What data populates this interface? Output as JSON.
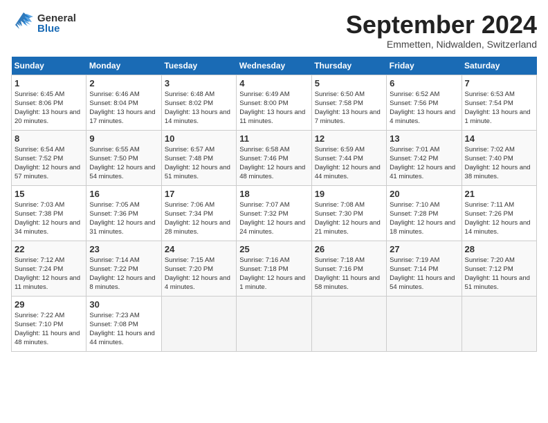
{
  "header": {
    "logo_general": "General",
    "logo_blue": "Blue",
    "month_title": "September 2024",
    "location": "Emmetten, Nidwalden, Switzerland"
  },
  "days_of_week": [
    "Sunday",
    "Monday",
    "Tuesday",
    "Wednesday",
    "Thursday",
    "Friday",
    "Saturday"
  ],
  "weeks": [
    [
      {
        "day": 1,
        "sunrise": "6:45 AM",
        "sunset": "8:06 PM",
        "daylight": "13 hours and 20 minutes."
      },
      {
        "day": 2,
        "sunrise": "6:46 AM",
        "sunset": "8:04 PM",
        "daylight": "13 hours and 17 minutes."
      },
      {
        "day": 3,
        "sunrise": "6:48 AM",
        "sunset": "8:02 PM",
        "daylight": "13 hours and 14 minutes."
      },
      {
        "day": 4,
        "sunrise": "6:49 AM",
        "sunset": "8:00 PM",
        "daylight": "13 hours and 11 minutes."
      },
      {
        "day": 5,
        "sunrise": "6:50 AM",
        "sunset": "7:58 PM",
        "daylight": "13 hours and 7 minutes."
      },
      {
        "day": 6,
        "sunrise": "6:52 AM",
        "sunset": "7:56 PM",
        "daylight": "13 hours and 4 minutes."
      },
      {
        "day": 7,
        "sunrise": "6:53 AM",
        "sunset": "7:54 PM",
        "daylight": "13 hours and 1 minute."
      }
    ],
    [
      {
        "day": 8,
        "sunrise": "6:54 AM",
        "sunset": "7:52 PM",
        "daylight": "12 hours and 57 minutes."
      },
      {
        "day": 9,
        "sunrise": "6:55 AM",
        "sunset": "7:50 PM",
        "daylight": "12 hours and 54 minutes."
      },
      {
        "day": 10,
        "sunrise": "6:57 AM",
        "sunset": "7:48 PM",
        "daylight": "12 hours and 51 minutes."
      },
      {
        "day": 11,
        "sunrise": "6:58 AM",
        "sunset": "7:46 PM",
        "daylight": "12 hours and 48 minutes."
      },
      {
        "day": 12,
        "sunrise": "6:59 AM",
        "sunset": "7:44 PM",
        "daylight": "12 hours and 44 minutes."
      },
      {
        "day": 13,
        "sunrise": "7:01 AM",
        "sunset": "7:42 PM",
        "daylight": "12 hours and 41 minutes."
      },
      {
        "day": 14,
        "sunrise": "7:02 AM",
        "sunset": "7:40 PM",
        "daylight": "12 hours and 38 minutes."
      }
    ],
    [
      {
        "day": 15,
        "sunrise": "7:03 AM",
        "sunset": "7:38 PM",
        "daylight": "12 hours and 34 minutes."
      },
      {
        "day": 16,
        "sunrise": "7:05 AM",
        "sunset": "7:36 PM",
        "daylight": "12 hours and 31 minutes."
      },
      {
        "day": 17,
        "sunrise": "7:06 AM",
        "sunset": "7:34 PM",
        "daylight": "12 hours and 28 minutes."
      },
      {
        "day": 18,
        "sunrise": "7:07 AM",
        "sunset": "7:32 PM",
        "daylight": "12 hours and 24 minutes."
      },
      {
        "day": 19,
        "sunrise": "7:08 AM",
        "sunset": "7:30 PM",
        "daylight": "12 hours and 21 minutes."
      },
      {
        "day": 20,
        "sunrise": "7:10 AM",
        "sunset": "7:28 PM",
        "daylight": "12 hours and 18 minutes."
      },
      {
        "day": 21,
        "sunrise": "7:11 AM",
        "sunset": "7:26 PM",
        "daylight": "12 hours and 14 minutes."
      }
    ],
    [
      {
        "day": 22,
        "sunrise": "7:12 AM",
        "sunset": "7:24 PM",
        "daylight": "12 hours and 11 minutes."
      },
      {
        "day": 23,
        "sunrise": "7:14 AM",
        "sunset": "7:22 PM",
        "daylight": "12 hours and 8 minutes."
      },
      {
        "day": 24,
        "sunrise": "7:15 AM",
        "sunset": "7:20 PM",
        "daylight": "12 hours and 4 minutes."
      },
      {
        "day": 25,
        "sunrise": "7:16 AM",
        "sunset": "7:18 PM",
        "daylight": "12 hours and 1 minute."
      },
      {
        "day": 26,
        "sunrise": "7:18 AM",
        "sunset": "7:16 PM",
        "daylight": "11 hours and 58 minutes."
      },
      {
        "day": 27,
        "sunrise": "7:19 AM",
        "sunset": "7:14 PM",
        "daylight": "11 hours and 54 minutes."
      },
      {
        "day": 28,
        "sunrise": "7:20 AM",
        "sunset": "7:12 PM",
        "daylight": "11 hours and 51 minutes."
      }
    ],
    [
      {
        "day": 29,
        "sunrise": "7:22 AM",
        "sunset": "7:10 PM",
        "daylight": "11 hours and 48 minutes."
      },
      {
        "day": 30,
        "sunrise": "7:23 AM",
        "sunset": "7:08 PM",
        "daylight": "11 hours and 44 minutes."
      },
      null,
      null,
      null,
      null,
      null
    ]
  ]
}
